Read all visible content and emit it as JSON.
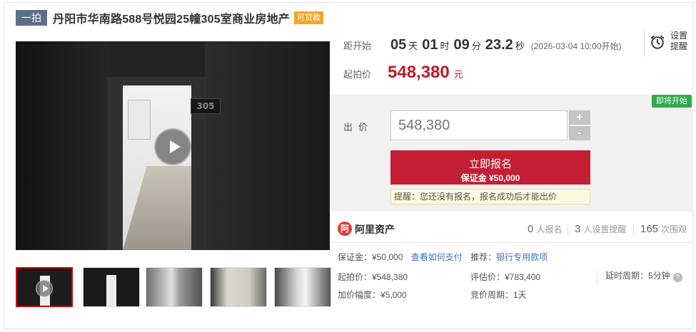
{
  "title": {
    "lot_tag": "一拍",
    "name": "丹阳市华南路588号悦园25幢305室商业房地产",
    "loan_tag": "可贷款"
  },
  "media": {
    "room_plate": "305"
  },
  "countdown": {
    "label": "距开始",
    "days": "05",
    "days_unit": "天",
    "hours": "01",
    "hours_unit": "时",
    "minutes": "09",
    "minutes_unit": "分",
    "seconds": "23.2",
    "seconds_unit": "秒",
    "start_time": "(2026-03-04 10:00开始)"
  },
  "remind": {
    "line1": "设置",
    "line2": "提醒"
  },
  "start_price": {
    "label": "起拍价",
    "value": "548,380",
    "unit": "元"
  },
  "bid": {
    "status_badge": "即将开始",
    "label": "出价",
    "input_value": "548,380",
    "plus": "+",
    "minus": "-",
    "register_label": "立即报名",
    "deposit_label": "保证金 ¥50,000",
    "tip": "提醒：您还没有报名，报名成功后才能出价"
  },
  "platform": {
    "logo_char": "阿",
    "name": "阿里资产"
  },
  "stats": {
    "registered_count": "0",
    "registered_label": "人报名",
    "reminder_count": "3",
    "reminder_label": "人设置提醒",
    "views_count": "165",
    "views_label": "次围观"
  },
  "details": {
    "deposit_label": "保证金：¥50,000",
    "deposit_link": "查看如何支付",
    "recommend_label": "推荐：",
    "recommend_link": "银行专用款项",
    "start_price": "起拍价：¥548,380",
    "appraisal": "评估价：¥783,400",
    "delay_period": "延时周期：5分钟",
    "increment": "加价幅度：¥5,000",
    "bid_period": "竞价周期：1天"
  },
  "colors": {
    "accent_red": "#c41e35",
    "price_red": "#b71c2e",
    "link_blue": "#3b73b9",
    "badge_green": "#2eaa4a",
    "lot_tag_bg": "#5c6f86",
    "loan_tag_bg": "#f5a623"
  }
}
